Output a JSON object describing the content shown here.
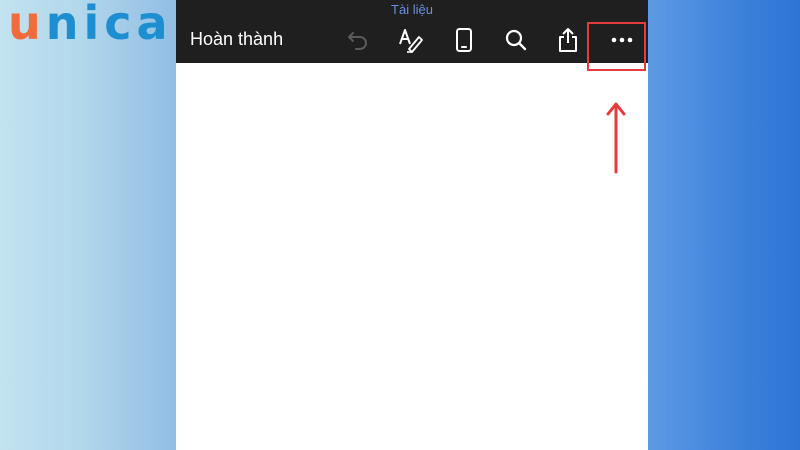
{
  "branding": {
    "logo_first": "u",
    "logo_rest": "nica"
  },
  "toolbar": {
    "document_title": "Tài liệu",
    "done_label": "Hoàn thành",
    "icons": [
      "undo-icon",
      "draw-pen-icon",
      "mobile-view-icon",
      "search-icon",
      "share-icon",
      "more-icon"
    ]
  },
  "colors": {
    "toolbar_bg": "#1f1f1f",
    "title_color": "#6b8fe0",
    "highlight": "#e43b3b",
    "logo_orange": "#f26b3a",
    "logo_blue": "#1d8fd1"
  }
}
